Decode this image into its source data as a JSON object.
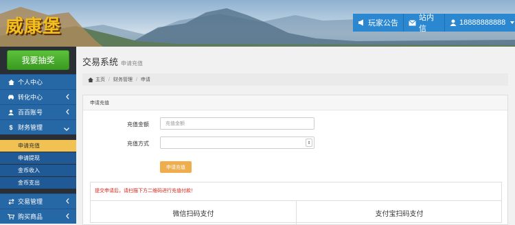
{
  "header": {
    "logo_text": "威康堡",
    "announcement_label": "玩家公告",
    "messages_label": "站内信",
    "user_label": "18888888888"
  },
  "sidebar": {
    "lottery_button": "我要抽奖",
    "items": [
      {
        "label": "个人中心",
        "icon": "home-icon"
      },
      {
        "label": "转化中心",
        "icon": "car-icon"
      },
      {
        "label": "百百账号",
        "icon": "user-icon"
      },
      {
        "label": "财务管理",
        "icon": "dollar-icon"
      },
      {
        "label": "交易管理",
        "icon": "exchange-icon"
      },
      {
        "label": "购买商品",
        "icon": "cart-icon"
      }
    ],
    "subitems": [
      {
        "label": "申请充值",
        "active": true
      },
      {
        "label": "申请提现",
        "active": false
      },
      {
        "label": "金币收入",
        "active": false
      },
      {
        "label": "金币支出",
        "active": false
      }
    ]
  },
  "main": {
    "title": "交易系统",
    "subtitle": "申请充值",
    "breadcrumb": [
      "主页",
      "财务管理",
      "申请"
    ],
    "panel_title": "申请充值",
    "amount_label": "充值金额",
    "amount_placeholder": "充值金额",
    "method_label": "充值方式",
    "method_value": "",
    "submit_label": "申请充值",
    "alert": "提交申请后，请扫描下方二维码进行充值付款！",
    "wechat_pay": "微信扫码支付",
    "alipay_pay": "支付宝扫码支付"
  },
  "colors": {
    "header_button": "#2a87d0",
    "sidebar_item": "#2667a6",
    "active_subitem": "#f1c152",
    "submit_button": "#f0ad4e",
    "lottery_button": "#4cae2f",
    "alert_text": "#d9261c"
  }
}
